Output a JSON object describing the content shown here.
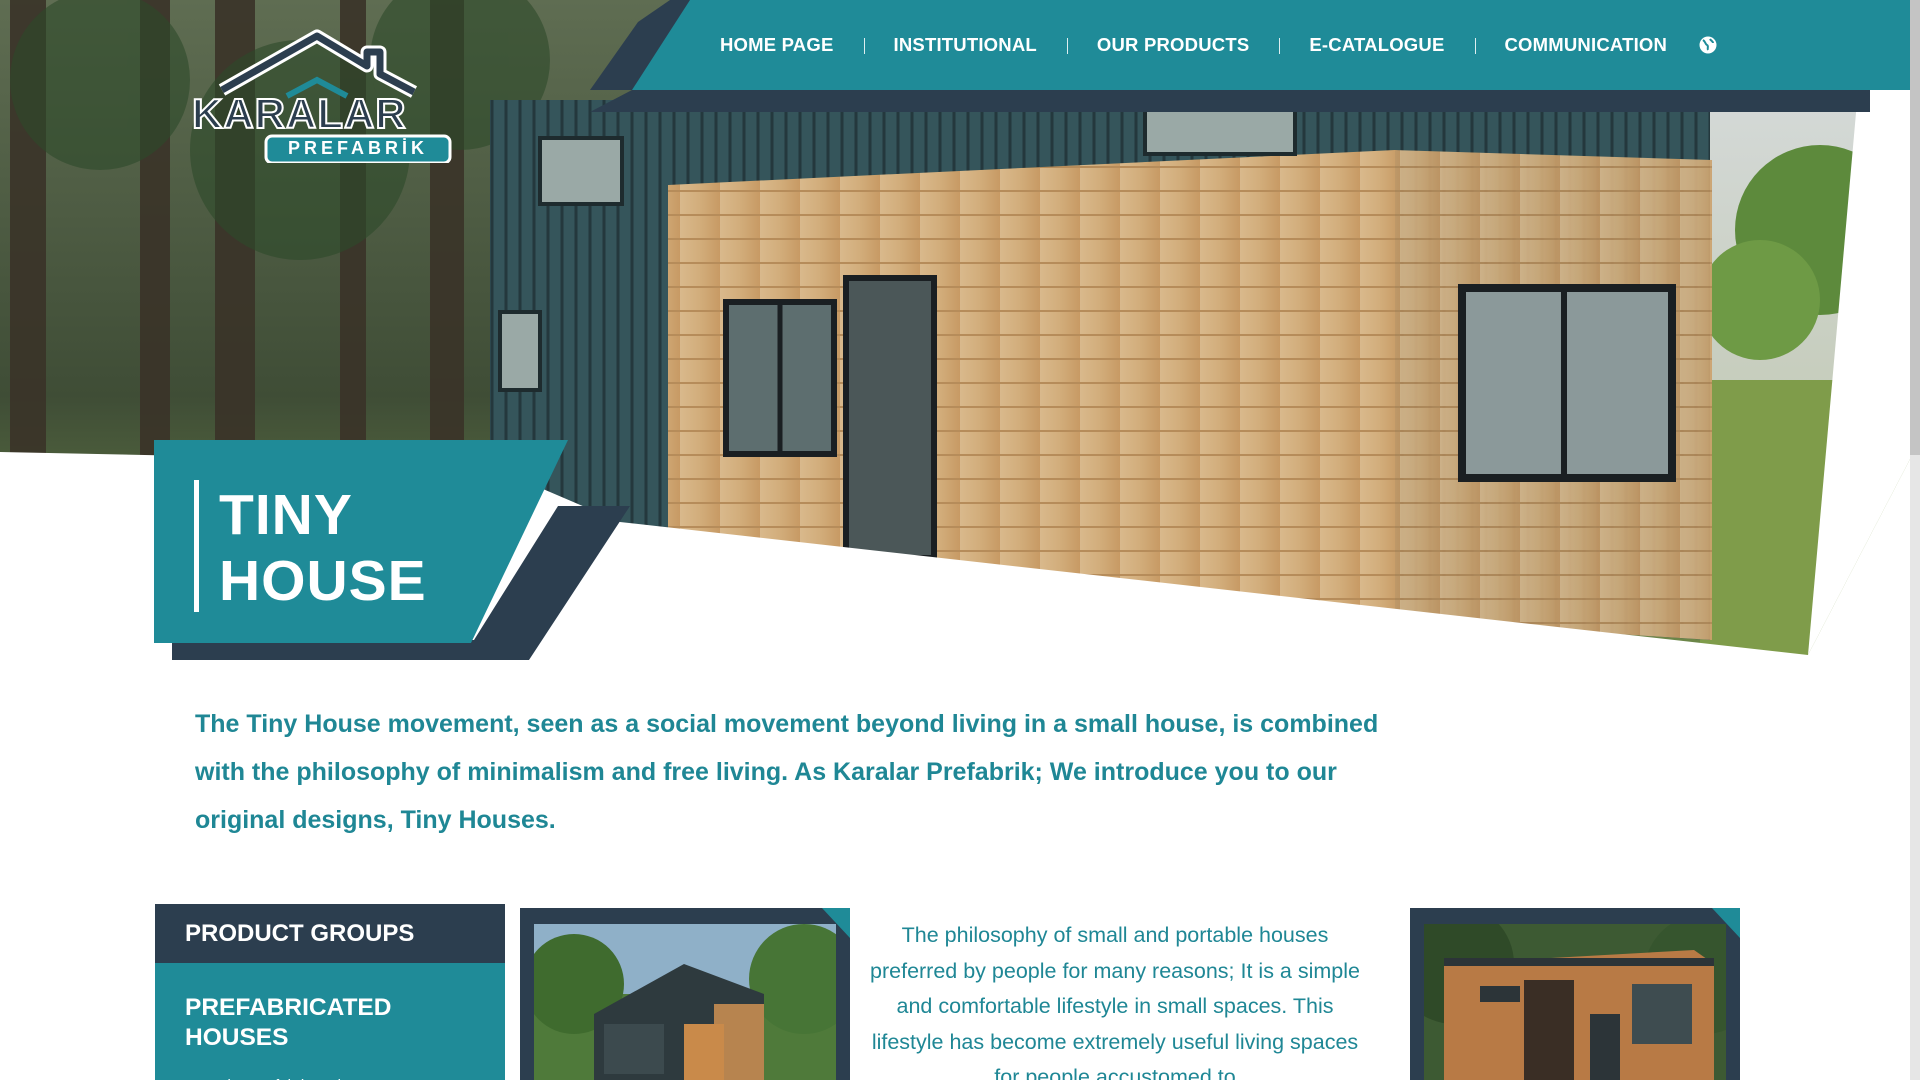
{
  "brand": {
    "logo_main": "KARALAR",
    "logo_sub": "PREFABRİK"
  },
  "nav": {
    "items": [
      {
        "label": "HOME PAGE"
      },
      {
        "label": "INSTITUTIONAL"
      },
      {
        "label": "OUR PRODUCTS"
      },
      {
        "label": "E-CATALOGUE"
      },
      {
        "label": "COMMUNICATION"
      }
    ],
    "language_icon": "globe-icon"
  },
  "hero": {
    "title_line1": "TINY",
    "title_line2": "HOUSE"
  },
  "intro": {
    "text": "The Tiny House movement, seen as a social movement beyond living in a small house, is combined with the philosophy of minimalism and free living. As Karalar Prefabrik; We introduce you to our original designs, Tiny Houses."
  },
  "product_groups": {
    "heading": "PRODUCT GROUPS",
    "first_item": "PREFABRICATED HOUSES",
    "first_sub": "Sunceion Prefabricated W..."
  },
  "content": {
    "paragraph": "The philosophy of small and portable houses preferred by people for many reasons; It is a simple and comfortable lifestyle in small spaces. This lifestyle has become extremely useful living spaces for people accustomed to"
  },
  "colors": {
    "teal": "#1f8b98",
    "dark_navy": "#2c3e4f",
    "text_teal": "#1f8795",
    "white": "#ffffff"
  }
}
